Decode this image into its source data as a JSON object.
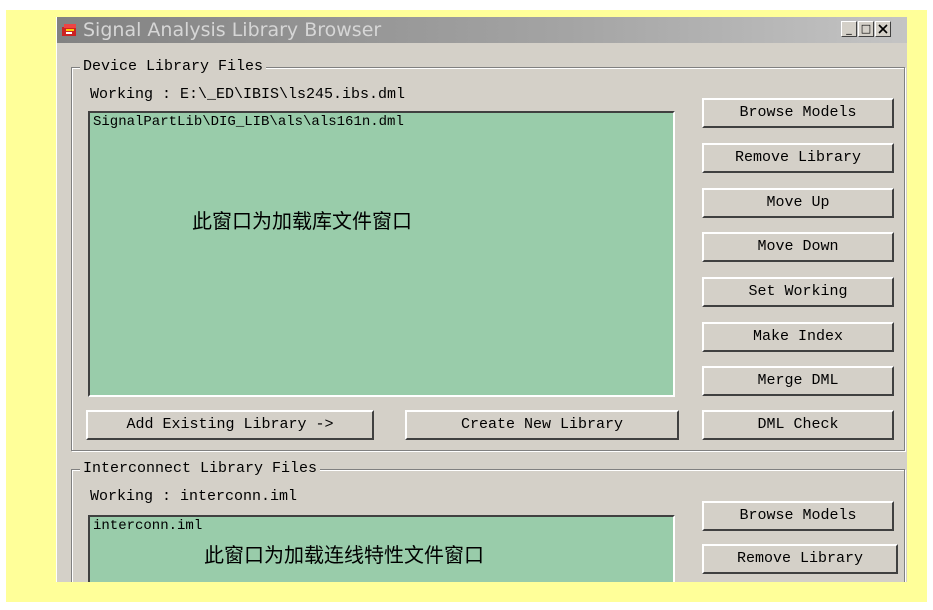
{
  "window": {
    "title": "Signal Analysis Library Browser",
    "minimize_label": "_",
    "maximize_label": "□"
  },
  "device": {
    "group_label": "Device Library Files",
    "working_text": "Working : E:\\_ED\\IBIS\\ls245.ibs.dml",
    "list_items": [
      "SignalPartLib\\DIG_LIB\\als\\als161n.dml"
    ],
    "overlay_text": "此窗口为加载库文件窗口",
    "buttons": {
      "browse_models": "Browse Models",
      "remove_library": "Remove Library",
      "move_up": "Move Up",
      "move_down": "Move Down",
      "set_working": "Set Working",
      "make_index": "Make Index",
      "merge_dml": "Merge DML",
      "dml_check": "DML Check",
      "add_existing": "Add Existing Library ->",
      "create_new": "Create New Library"
    }
  },
  "interconnect": {
    "group_label": "Interconnect Library Files",
    "working_text": "Working : interconn.iml",
    "list_items": [
      "interconn.iml"
    ],
    "overlay_text": "此窗口为加载连线特性文件窗口",
    "buttons": {
      "browse_models": "Browse Models",
      "remove_library": "Remove Library"
    }
  }
}
